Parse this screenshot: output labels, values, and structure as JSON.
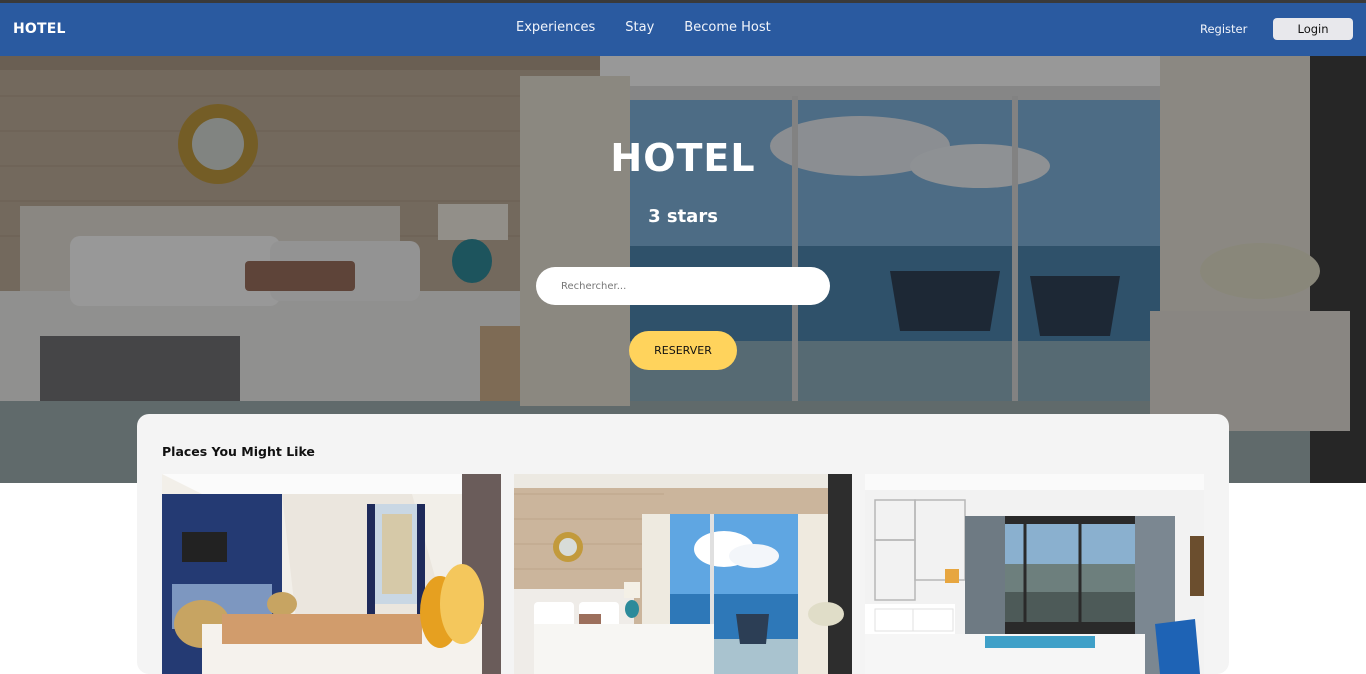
{
  "navbar": {
    "brand": "HOTEL",
    "links": [
      "Experiences",
      "Stay",
      "Become Host"
    ],
    "register": "Register",
    "login": "Login"
  },
  "hero": {
    "title": "HOTEL",
    "subtitle": "3 stars",
    "search_placeholder": "Rechercher...",
    "reserve_label": "RESERVER"
  },
  "places": {
    "title": "Places You Might Like",
    "cards": [
      {
        "image": "hotel-room-photo-blue-wall"
      },
      {
        "image": "hotel-room-photo-sea-view"
      },
      {
        "image": "hotel-room-photo-city-view"
      }
    ]
  },
  "colors": {
    "navbar": "#2a5aa0",
    "reserve_button": "#ffd35c",
    "panel": "#f4f4f4"
  }
}
